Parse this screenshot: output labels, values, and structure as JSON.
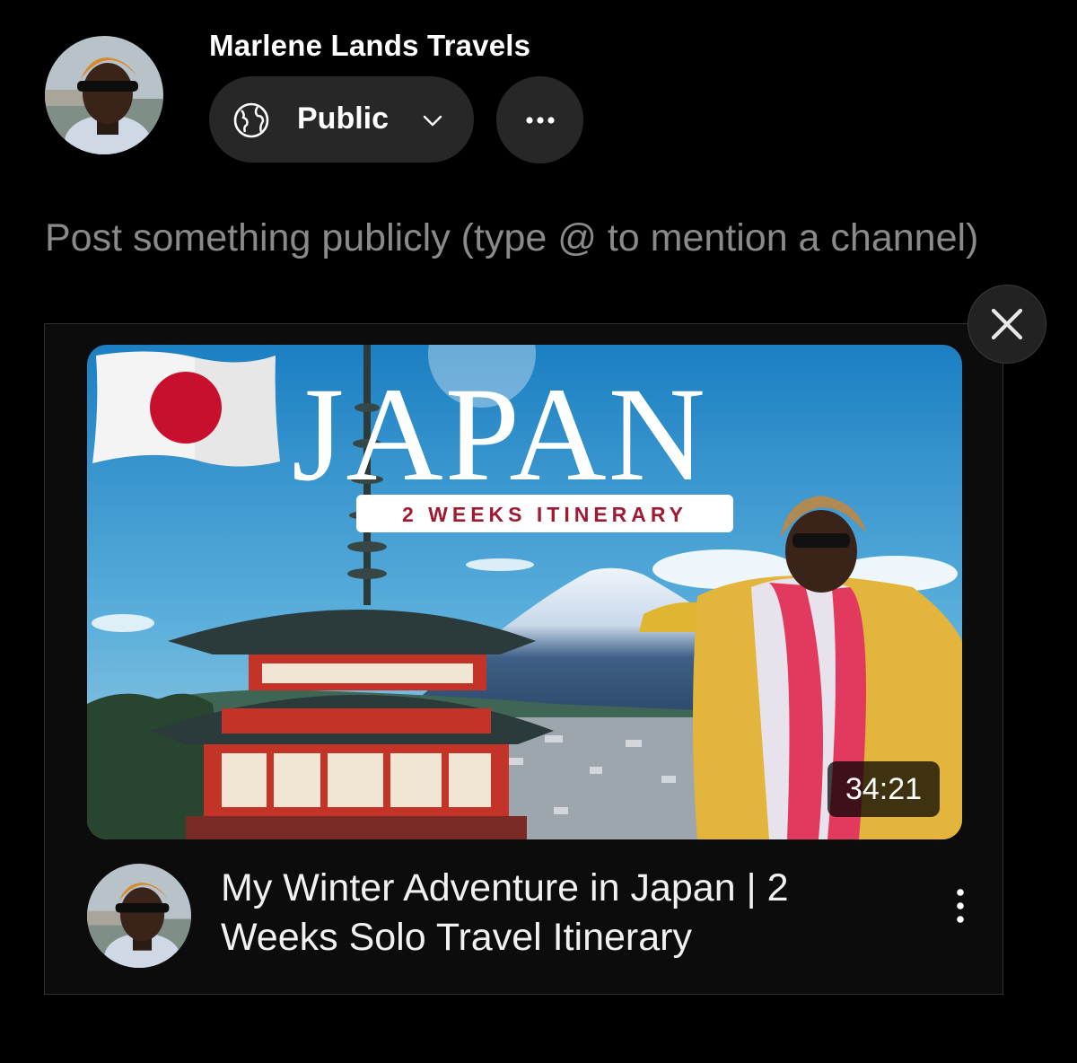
{
  "author": {
    "name": "Marlene Lands Travels",
    "avatar_icon": "channel-avatar-photo"
  },
  "visibility": {
    "label": "Public",
    "icon": "globe-icon",
    "dropdown_icon": "chevron-down-icon"
  },
  "more_button": {
    "icon": "more-horizontal-icon"
  },
  "composer": {
    "placeholder": "Post something publicly (type @ to mention a channel)"
  },
  "attachment": {
    "close_icon": "close-icon",
    "thumbnail": {
      "headline": "JAPAN",
      "subheadline": "2 WEEKS ITINERARY",
      "duration": "34:21"
    },
    "title": "My Winter Adventure in Japan | 2 Weeks Solo Travel Itinerary",
    "menu_icon": "more-vertical-icon"
  },
  "colors": {
    "background": "#000000",
    "pill": "#272727",
    "placeholder": "#8a8a8a",
    "flag_red": "#c8102e"
  }
}
